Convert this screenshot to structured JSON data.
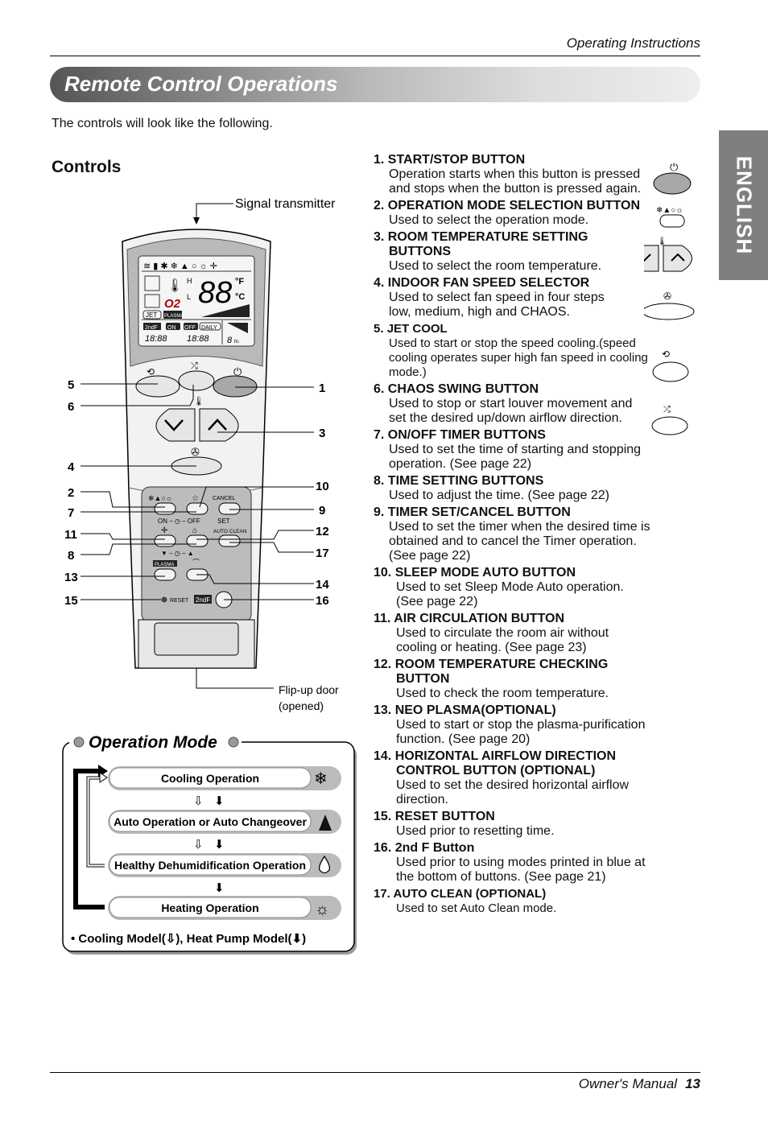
{
  "header": {
    "section": "Operating Instructions"
  },
  "banner": {
    "title": "Remote Control Operations"
  },
  "intro": "The controls will look like the following.",
  "controls_heading": "Controls",
  "language_tab": "ENGLISH",
  "remote": {
    "signal_label": "Signal transmitter",
    "door_label_1": "Flip-up door",
    "door_label_2": "(opened)",
    "display": {
      "digits": "88",
      "unit_f": "°F",
      "unit_c": "°C",
      "jet": "JET",
      "plasma": "PLASMA",
      "second_f": "2ndF",
      "on": "ON",
      "off": "OFF",
      "daily": "DAILY",
      "time_on": "18:88",
      "time_off": "18:88",
      "hours": "8",
      "hr": "hr.",
      "o2": "O2",
      "hi": "H",
      "lo": "L"
    },
    "panel_labels": {
      "cancel": "CANCEL",
      "set": "SET",
      "on_off": "ON – ◷ – OFF",
      "auto_clean": "AUTO CLEAN",
      "time_adj": "▼ – ◷ – ▲",
      "plasma": "PLASMA",
      "reset": "RESET",
      "second_f": "2ndF"
    },
    "callouts_left": [
      "5",
      "6",
      "4",
      "2",
      "7",
      "11",
      "8",
      "13",
      "15"
    ],
    "callouts_right": [
      "1",
      "3",
      "10",
      "9",
      "12",
      "17",
      "14",
      "16"
    ]
  },
  "items": [
    {
      "num": "1.",
      "title": "START/STOP BUTTON",
      "desc": "Operation starts when this button is pressed and stops when the button is pressed again."
    },
    {
      "num": "2.",
      "title": "OPERATION MODE SELECTION BUTTON",
      "desc": "Used to select the operation mode."
    },
    {
      "num": "3.",
      "title": "ROOM TEMPERATURE SETTING",
      "title2": "BUTTONS",
      "desc": "Used to select the room temperature."
    },
    {
      "num": "4.",
      "title": "INDOOR FAN SPEED SELECTOR",
      "desc": "Used to select fan speed in four steps low, medium, high and CHAOS."
    },
    {
      "num": "5.",
      "title": "JET COOL",
      "desc": "Used to start or stop the speed cooling.(speed cooling operates super high fan speed in cooling mode.)"
    },
    {
      "num": "6.",
      "title": "CHAOS SWING BUTTON",
      "desc": "Used to stop or start louver movement and set the desired up/down airflow direction."
    },
    {
      "num": "7.",
      "title": "ON/OFF TIMER BUTTONS",
      "desc": "Used to set the time of starting and stopping operation. (See page 22)"
    },
    {
      "num": "8.",
      "title": "TIME SETTING BUTTONS",
      "desc": "Used to adjust the time. (See page 22)"
    },
    {
      "num": "9.",
      "title": "TIMER SET/CANCEL BUTTON",
      "desc": "Used to set the timer when the desired time is obtained and to cancel the Timer operation. (See page 22)"
    },
    {
      "num": "10.",
      "title": "SLEEP MODE AUTO BUTTON",
      "desc": "Used to set Sleep Mode Auto operation. (See page 22)"
    },
    {
      "num": "11.",
      "title": "AIR CIRCULATION BUTTON",
      "desc": "Used to circulate the room air without cooling or heating. (See page 23)"
    },
    {
      "num": "12.",
      "title": "ROOM TEMPERATURE CHECKING",
      "title2": "BUTTON",
      "desc": "Used to check the room temperature."
    },
    {
      "num": "13.",
      "title": "NEO PLASMA(OPTIONAL)",
      "desc": "Used to start or stop the plasma-purification function. (See page 20)"
    },
    {
      "num": "14.",
      "title": "HORIZONTAL AIRFLOW DIRECTION",
      "title2": "CONTROL BUTTON (OPTIONAL)",
      "desc": "Used to set the desired horizontal airflow direction."
    },
    {
      "num": "15.",
      "title": "RESET BUTTON",
      "desc": "Used prior to resetting time."
    },
    {
      "num": "16.",
      "title": "2nd F Button",
      "desc": "Used prior to using modes printed in blue at the bottom of buttons. (See page 21)"
    },
    {
      "num": "17.",
      "title": "AUTO CLEAN (OPTIONAL)",
      "desc": "Used to set Auto Clean mode."
    }
  ],
  "operation_mode": {
    "title": "Operation Mode",
    "modes": [
      {
        "label": "Cooling Operation",
        "icon": "snowflake-icon"
      },
      {
        "label": "Auto Operation or Auto Changeover",
        "icon": "auto-mode-icon"
      },
      {
        "label": "Healthy Dehumidification Operation",
        "icon": "droplet-icon"
      },
      {
        "label": "Heating Operation",
        "icon": "sun-icon"
      }
    ],
    "legend_prefix": "• Cooling Model(",
    "legend_mid": "), Heat Pump Model(",
    "legend_suffix": ")"
  },
  "footer": {
    "manual": "Owner's Manual",
    "page": "13"
  },
  "colors": {
    "tab_bg": "#7f7f7f",
    "remote_panel": "#bcbcbc",
    "button_fill": "#e6e6e6",
    "start_button": "#a8a8a8"
  }
}
